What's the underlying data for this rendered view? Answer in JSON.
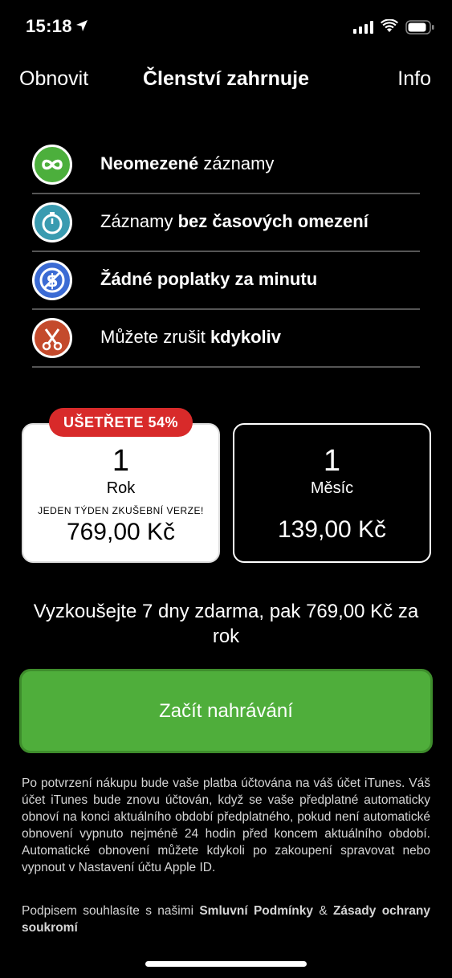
{
  "status_bar": {
    "time": "15:18"
  },
  "nav": {
    "left": "Obnovit",
    "title": "Členství zahrnuje",
    "right": "Info"
  },
  "features": [
    {
      "icon": "infinity-icon",
      "color": "#4caf3c",
      "bold_first": "Neomezené",
      "text_after": " záznamy",
      "text_before": "",
      "bold_last": ""
    },
    {
      "icon": "stopwatch-icon",
      "color": "#3a9bb0",
      "text_before": "Záznamy ",
      "bold_last": "bez časových omezení",
      "bold_first": "",
      "text_after": ""
    },
    {
      "icon": "no-dollar-icon",
      "color": "#3b6bd4",
      "bold_first": "Žádné poplatky za minutu",
      "text_after": "",
      "text_before": "",
      "bold_last": ""
    },
    {
      "icon": "scissors-icon",
      "color": "#c44a2c",
      "text_before": "Můžete zrušit ",
      "bold_last": "kdykoliv",
      "bold_first": "",
      "text_after": ""
    }
  ],
  "plans": {
    "badge": "UŠETŘETE 54%",
    "year": {
      "num": "1",
      "unit": "Rok",
      "trial": "JEDEN TÝDEN ZKUŠEBNÍ VERZE!",
      "price": "769,00 Kč"
    },
    "month": {
      "num": "1",
      "unit": "Měsíc",
      "price": "139,00 Kč"
    }
  },
  "offer": "Vyzkoušejte 7 dny zdarma, pak 769,00 Kč za rok",
  "cta": "Začít nahrávání",
  "legal": "Po potvrzení nákupu bude vaše platba účtována na váš účet iTunes. Váš účet iTunes bude znovu účtován, když se vaše předplatné automaticky obnoví na konci aktuálního období předplatného, pokud není automatické obnovení vypnuto nejméně 24 hodin před koncem aktuálního období. Automatické obnovení můžete kdykoli po zakoupení spravovat nebo vypnout v Nastavení účtu Apple ID.",
  "legal2": {
    "prefix": "Podpisem souhlasíte s našimi ",
    "terms": "Smluvní Podmínky",
    "and": " & ",
    "privacy": "Zásady ochrany soukromí"
  },
  "colors": {
    "cta": "#4fae3b",
    "badge": "#d82a2a"
  }
}
